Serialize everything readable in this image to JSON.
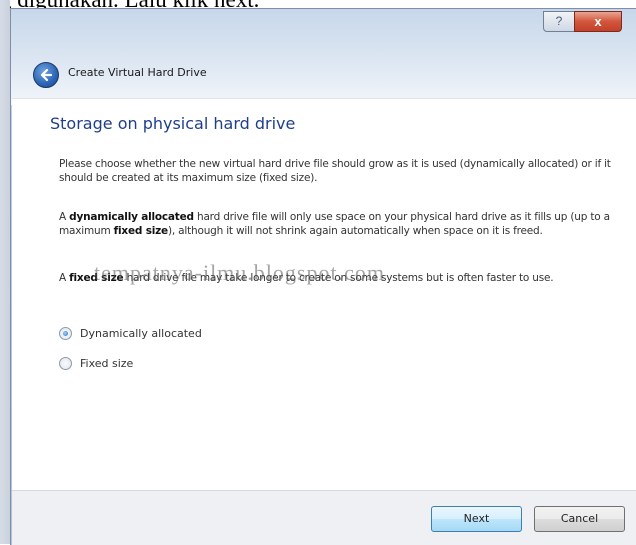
{
  "page_caption": "g digunakan. Lalu klik next.",
  "window": {
    "title": "Create Virtual Hard Drive",
    "help_glyph": "?",
    "close_glyph": "x"
  },
  "icons": {
    "back": "back-arrow-icon",
    "help": "help-icon",
    "close": "close-icon"
  },
  "content": {
    "heading": "Storage on physical hard drive",
    "para1": "Please choose whether the new virtual hard drive file should grow as it is used (dynamically allocated) or if it should be created at its maximum size (fixed size).",
    "para2": {
      "prefix": "A ",
      "bold1": "dynamically allocated",
      "mid": " hard drive file will only use space on your physical hard drive as it fills up (up to a maximum ",
      "bold2": "fixed size",
      "suffix": "), although it will not shrink again automatically when space on it is freed."
    },
    "para3": {
      "prefix": "A ",
      "bold": "fixed size",
      "suffix": " hard drive file may take longer to create on some systems but is often faster to use."
    },
    "watermark": "tempatnya-ilmu.blogspot.com",
    "options": [
      {
        "label": "Dynamically allocated",
        "selected": true
      },
      {
        "label": "Fixed size",
        "selected": false
      }
    ]
  },
  "footer": {
    "next_label": "Next",
    "cancel_label": "Cancel"
  },
  "colors": {
    "heading": "#1f3f8c",
    "close_button": "#c2412a",
    "next_border": "#3c7fb1"
  }
}
